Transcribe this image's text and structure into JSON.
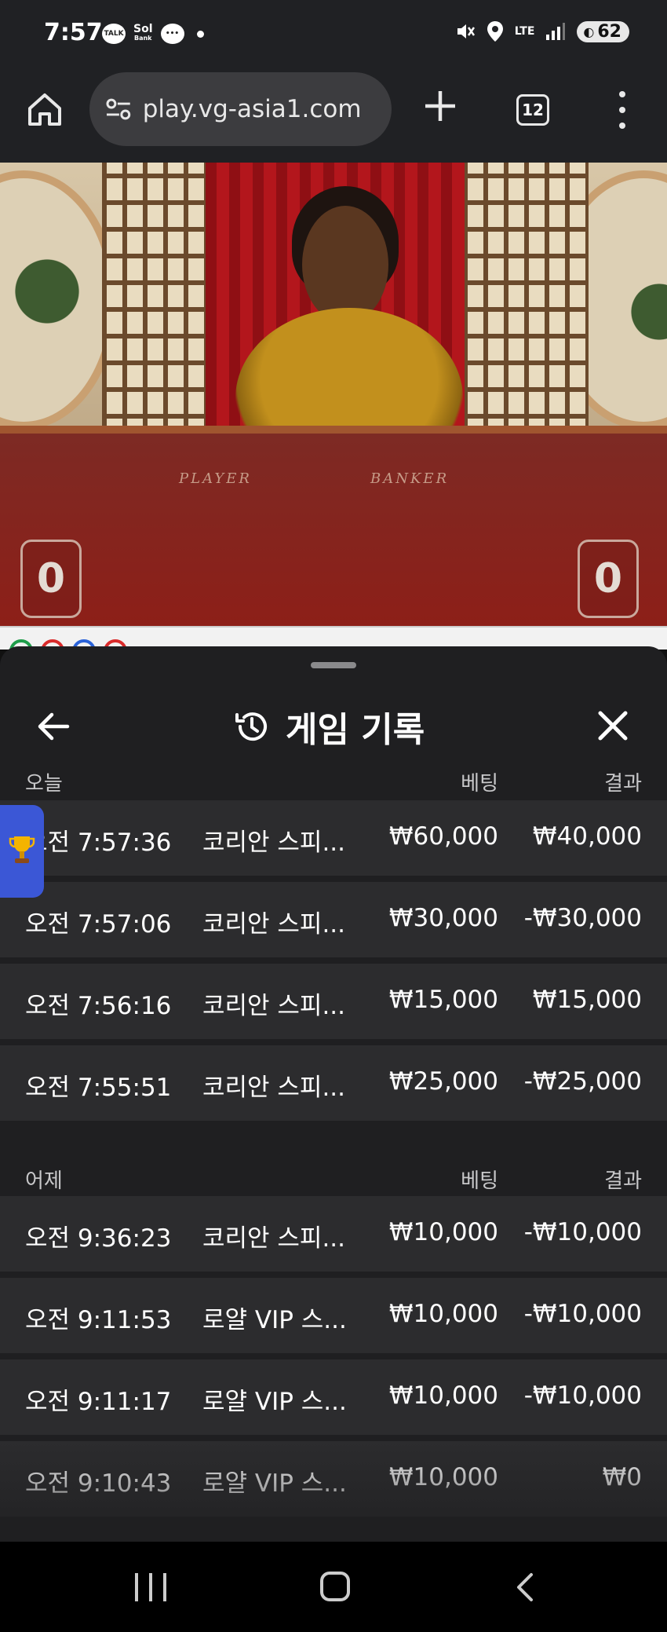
{
  "status_bar": {
    "time": "7:57",
    "apps": [
      "TALK",
      "SOL Bank",
      "message"
    ],
    "network": "LTE",
    "battery": "62"
  },
  "browser": {
    "url": "play.vg-asia1.com",
    "tab_count": "12"
  },
  "video": {
    "player_label": "PLAYER",
    "banker_label": "BANKER",
    "player_score": "0",
    "banker_score": "0"
  },
  "sheet": {
    "title": "게임 기록",
    "sections": [
      {
        "label": "오늘",
        "bet_header": "베팅",
        "result_header": "결과",
        "rows": [
          {
            "time": "오전 7:57:36",
            "game": "코리안 스피...",
            "bet": "₩60,000",
            "result": "₩40,000"
          },
          {
            "time": "오전 7:57:06",
            "game": "코리안 스피...",
            "bet": "₩30,000",
            "result": "-₩30,000"
          },
          {
            "time": "오전 7:56:16",
            "game": "코리안 스피...",
            "bet": "₩15,000",
            "result": "₩15,000"
          },
          {
            "time": "오전 7:55:51",
            "game": "코리안 스피...",
            "bet": "₩25,000",
            "result": "-₩25,000"
          }
        ]
      },
      {
        "label": "어제",
        "bet_header": "베팅",
        "result_header": "결과",
        "rows": [
          {
            "time": "오전 9:36:23",
            "game": "코리안 스피...",
            "bet": "₩10,000",
            "result": "-₩10,000"
          },
          {
            "time": "오전 9:11:53",
            "game": "로얄 VIP 스...",
            "bet": "₩10,000",
            "result": "-₩10,000"
          },
          {
            "time": "오전 9:11:17",
            "game": "로얄 VIP 스...",
            "bet": "₩10,000",
            "result": "-₩10,000"
          },
          {
            "time": "오전 9:10:43",
            "game": "로얄 VIP 스...",
            "bet": "₩10,000",
            "result": "₩0"
          }
        ]
      }
    ]
  },
  "colors": {
    "sheet_bg": "#1f1f21",
    "row_bg": "#2c2c2e",
    "trophy_tab": "#3b57d6",
    "table_felt": "#8d1f18"
  },
  "icons": {
    "home": "home-icon",
    "site_settings": "tune-icon",
    "new_tab": "plus-icon",
    "tabs": "tab-counter-icon",
    "menu": "more-vert-icon",
    "back": "arrow-left-icon",
    "history": "history-icon",
    "close": "close-icon",
    "trophy": "trophy-icon"
  }
}
